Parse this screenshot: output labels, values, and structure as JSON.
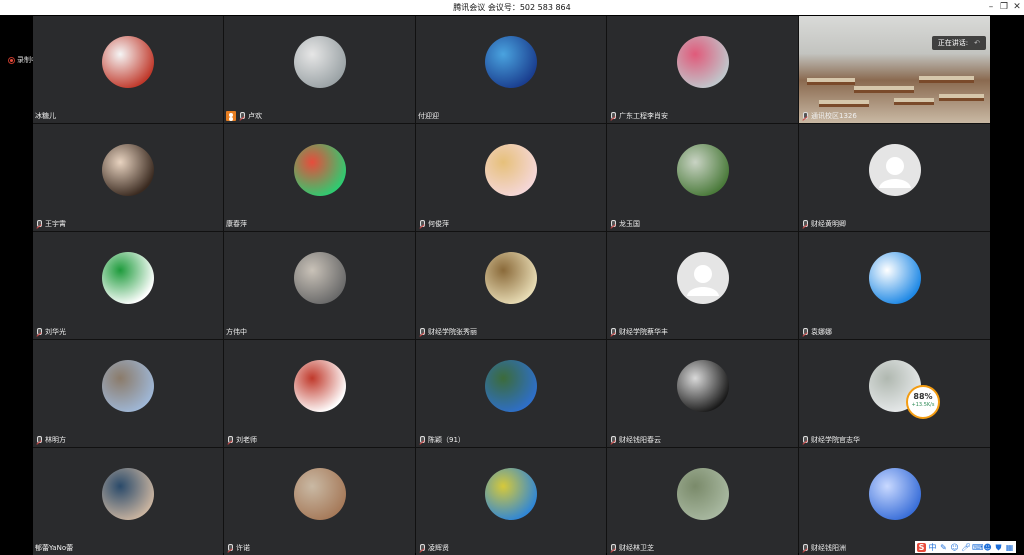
{
  "window": {
    "title": "腾讯会议 会议号：502 583 864",
    "controls": [
      "minimize",
      "restore",
      "close"
    ]
  },
  "recording": {
    "label": "录制中"
  },
  "speaking": {
    "label": "正在讲话:"
  },
  "network_badge": {
    "percent": "88%",
    "speed": "+13.5K/s"
  },
  "participants": [
    {
      "name": "冰糖儿",
      "icon": "none",
      "avatar": "red-gift",
      "colors": [
        "#c0392b",
        "#f5f5f5"
      ]
    },
    {
      "name": "卢欢",
      "icon": "host-mic",
      "avatar": "cat",
      "colors": [
        "#9ba3a6",
        "#e6e6e6"
      ]
    },
    {
      "name": "付迎迎",
      "icon": "none",
      "avatar": "blue-swirl",
      "colors": [
        "#1a3e8f",
        "#4aa3df"
      ]
    },
    {
      "name": "广东工程李肖安",
      "icon": "mic",
      "avatar": "pink-flowers",
      "colors": [
        "#c0c7cc",
        "#e05a7a"
      ]
    },
    {
      "name": "通讯校区1326",
      "icon": "mic",
      "avatar": "live-video",
      "colors": [
        "#c3c4c0",
        "#8a6a50"
      ]
    },
    {
      "name": "王宇霄",
      "icon": "mic",
      "avatar": "girl-portrait",
      "colors": [
        "#3a2a20",
        "#e8d3c0"
      ]
    },
    {
      "name": "康春萍",
      "icon": "none",
      "avatar": "cartoon-couple",
      "colors": [
        "#2ecc71",
        "#e74c3c"
      ]
    },
    {
      "name": "何俊萍",
      "icon": "mic",
      "avatar": "flowers-cup",
      "colors": [
        "#f5d7d8",
        "#e6c07a"
      ]
    },
    {
      "name": "龙玉国",
      "icon": "mic",
      "avatar": "road-trees",
      "colors": [
        "#4a7a3a",
        "#c9d3c4"
      ]
    },
    {
      "name": "财经黄明卿",
      "icon": "mic",
      "avatar": "default-person",
      "colors": [
        "#e5e5e5",
        "#ffffff"
      ]
    },
    {
      "name": "刘华光",
      "icon": "mic",
      "avatar": "green-logo",
      "colors": [
        "#ffffff",
        "#1e9b3c"
      ]
    },
    {
      "name": "方伟中",
      "icon": "none",
      "avatar": "cafe-scene",
      "colors": [
        "#6a6a6a",
        "#c9c2b8"
      ]
    },
    {
      "name": "财经学院张秀丽",
      "icon": "mic",
      "avatar": "pattern",
      "colors": [
        "#e8dcb5",
        "#8a6a3a"
      ]
    },
    {
      "name": "财经学院蔡华丰",
      "icon": "mic",
      "avatar": "default-person",
      "colors": [
        "#e5e5e5",
        "#ffffff"
      ]
    },
    {
      "name": "袁娜娜",
      "icon": "mic",
      "avatar": "doraemon",
      "colors": [
        "#1e88e5",
        "#ffffff"
      ]
    },
    {
      "name": "林明方",
      "icon": "mic",
      "avatar": "landscape",
      "colors": [
        "#9fb7d6",
        "#8b7b6a"
      ]
    },
    {
      "name": "刘老师",
      "icon": "mic",
      "avatar": "bicycle-man",
      "colors": [
        "#ffffff",
        "#c0392b"
      ]
    },
    {
      "name": "陈颖（91）",
      "icon": "mic",
      "avatar": "lake",
      "colors": [
        "#2e6fc9",
        "#3c6b3a"
      ]
    },
    {
      "name": "财经钱阳春云",
      "icon": "mic",
      "avatar": "bw-portrait",
      "colors": [
        "#1a1a1a",
        "#d9d9d9"
      ]
    },
    {
      "name": "财经学院官志华",
      "icon": "mic",
      "avatar": "mist",
      "colors": [
        "#e6e9ea",
        "#b0b8b0"
      ]
    },
    {
      "name": "郁蕾YaNo蕾",
      "icon": "none",
      "avatar": "child-photo",
      "colors": [
        "#c9b4a0",
        "#2a4a6a"
      ]
    },
    {
      "name": "许诺",
      "icon": "mic",
      "avatar": "street-girl",
      "colors": [
        "#a67a5a",
        "#c9b9a4"
      ]
    },
    {
      "name": "凌辉贤",
      "icon": "mic",
      "avatar": "field",
      "colors": [
        "#2f86d6",
        "#d6c93a"
      ]
    },
    {
      "name": "财经林卫芝",
      "icon": "mic",
      "avatar": "hill",
      "colors": [
        "#a8b8a0",
        "#7a8a6a"
      ]
    },
    {
      "name": "财经钱阳洲",
      "icon": "mic",
      "avatar": "blue-lake",
      "colors": [
        "#3a6fd9",
        "#c9d9ff"
      ]
    }
  ],
  "tray": {
    "ime": "S",
    "lang": "中"
  }
}
